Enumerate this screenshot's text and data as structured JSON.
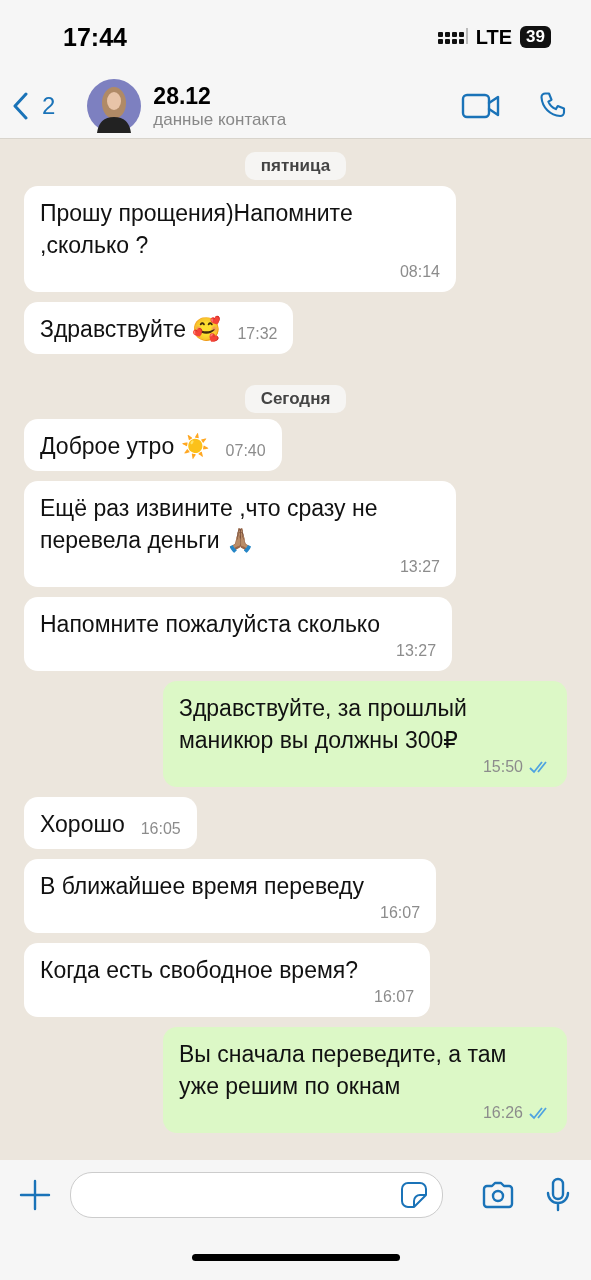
{
  "status_bar": {
    "time": "17:44",
    "network": "LTE",
    "battery": "39"
  },
  "header": {
    "back_count": "2",
    "title": "28.12",
    "subtitle": "данные контакта"
  },
  "messages": [
    {
      "kind": "date",
      "text": "пятница"
    },
    {
      "kind": "in",
      "text": "Прошу прощения)Напомните ,сколько ?",
      "time": "08:14"
    },
    {
      "kind": "in",
      "text": "Здравствуйте 🥰",
      "time": "17:32"
    },
    {
      "kind": "date",
      "text": "Сегодня"
    },
    {
      "kind": "in",
      "text": "Доброе утро ☀️",
      "time": "07:40"
    },
    {
      "kind": "in",
      "text": "Ещё раз извините ,что сразу не перевела деньги 🙏🏽",
      "time": "13:27"
    },
    {
      "kind": "in",
      "text": "Напомните пожалуйста сколько",
      "time": "13:27",
      "time_below": true
    },
    {
      "kind": "out",
      "text": "Здравствуйте, за прошлый маникюр вы должны 300₽",
      "time": "15:50",
      "read": true
    },
    {
      "kind": "in",
      "text": "Хорошо",
      "time": "16:05"
    },
    {
      "kind": "in",
      "text": "В ближайшее время переведу",
      "time": "16:07",
      "time_below": true
    },
    {
      "kind": "in",
      "text": "Когда есть свободное время?",
      "time": "16:07",
      "time_below": true
    },
    {
      "kind": "out",
      "text": "Вы сначала переведите, а там уже решим по окнам",
      "time": "16:26",
      "read": true
    }
  ]
}
